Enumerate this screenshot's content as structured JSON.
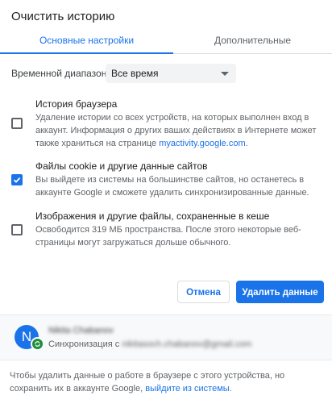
{
  "dialog": {
    "title": "Очистить историю"
  },
  "tabs": [
    {
      "label": "Основные настройки",
      "active": true
    },
    {
      "label": "Дополнительные",
      "active": false
    }
  ],
  "time_range": {
    "label": "Временной диапазон",
    "selected": "Все время"
  },
  "options": [
    {
      "title": "История браузера",
      "description": "Удаление истории со всех устройств, на которых выполнен вход в аккаунт. Информация о других ваших действиях в Интернете может также храниться на странице ",
      "link": "myactivity.google.com",
      "description_end": ".",
      "checked": false
    },
    {
      "title": "Файлы cookie и другие данные сайтов",
      "description": "Вы выйдете из системы на большинстве сайтов, но останетесь в аккаунте Google и сможете удалить синхронизированные данные.",
      "checked": true
    },
    {
      "title": "Изображения и другие файлы, сохраненные в кеше",
      "description": "Освободится 319 МБ пространства. После этого некоторые веб-страницы могут загружаться дольше обычного.",
      "checked": false
    }
  ],
  "buttons": {
    "cancel": "Отмена",
    "delete": "Удалить данные"
  },
  "account": {
    "avatar_letter": "N",
    "name": "Nikita Chabanov",
    "sync_label": "Синхронизация с ",
    "email": "nikitasoch.chabanov@gmail.com"
  },
  "footer": {
    "text": "Чтобы удалить данные о работе в браузере с этого устройства, но сохранить их в аккаунте Google, ",
    "link": "выйдите из системы",
    "text_end": "."
  },
  "colors": {
    "accent": "#1a73e8",
    "sync_green": "#1e8e3e"
  },
  "icons": {
    "dropdown": "chevron-down-icon",
    "check": "check-icon",
    "sync": "sync-icon"
  }
}
